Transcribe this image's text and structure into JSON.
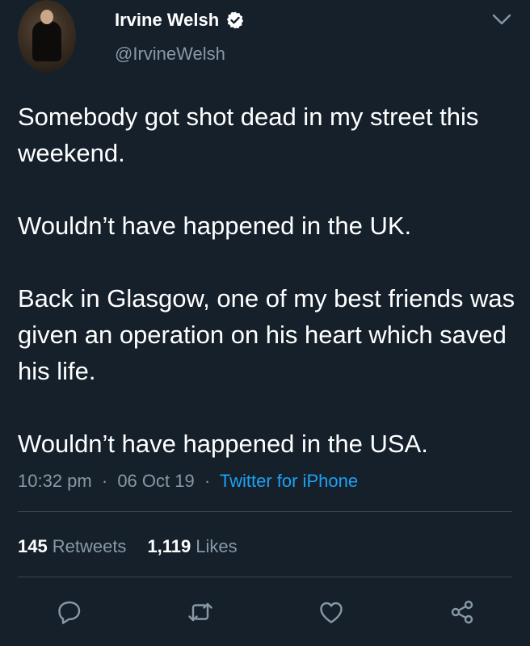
{
  "author": {
    "name": "Irvine Welsh",
    "handle": "@IrvineWelsh",
    "verified_icon": "verified-badge-icon"
  },
  "tweet": {
    "paragraphs": [
      "Somebody got shot dead in my street this weekend.",
      "Wouldn’t have happened in the UK.",
      "Back in Glasgow, one of my best friends was given an operation on his heart which saved his life.",
      "Wouldn’t have happened in the USA."
    ],
    "time": "10:32 pm",
    "date": "06 Oct 19",
    "source": "Twitter for iPhone",
    "separator": "·"
  },
  "stats": {
    "retweets_count": "145",
    "retweets_label": "Retweets",
    "likes_count": "1,119",
    "likes_label": "Likes"
  },
  "actions": [
    "reply-icon",
    "retweet-icon",
    "like-icon",
    "share-icon"
  ],
  "colors": {
    "background": "#15202b",
    "text": "#ffffff",
    "muted": "#8899a6",
    "accent": "#1da1f2",
    "divider": "#38444d"
  }
}
